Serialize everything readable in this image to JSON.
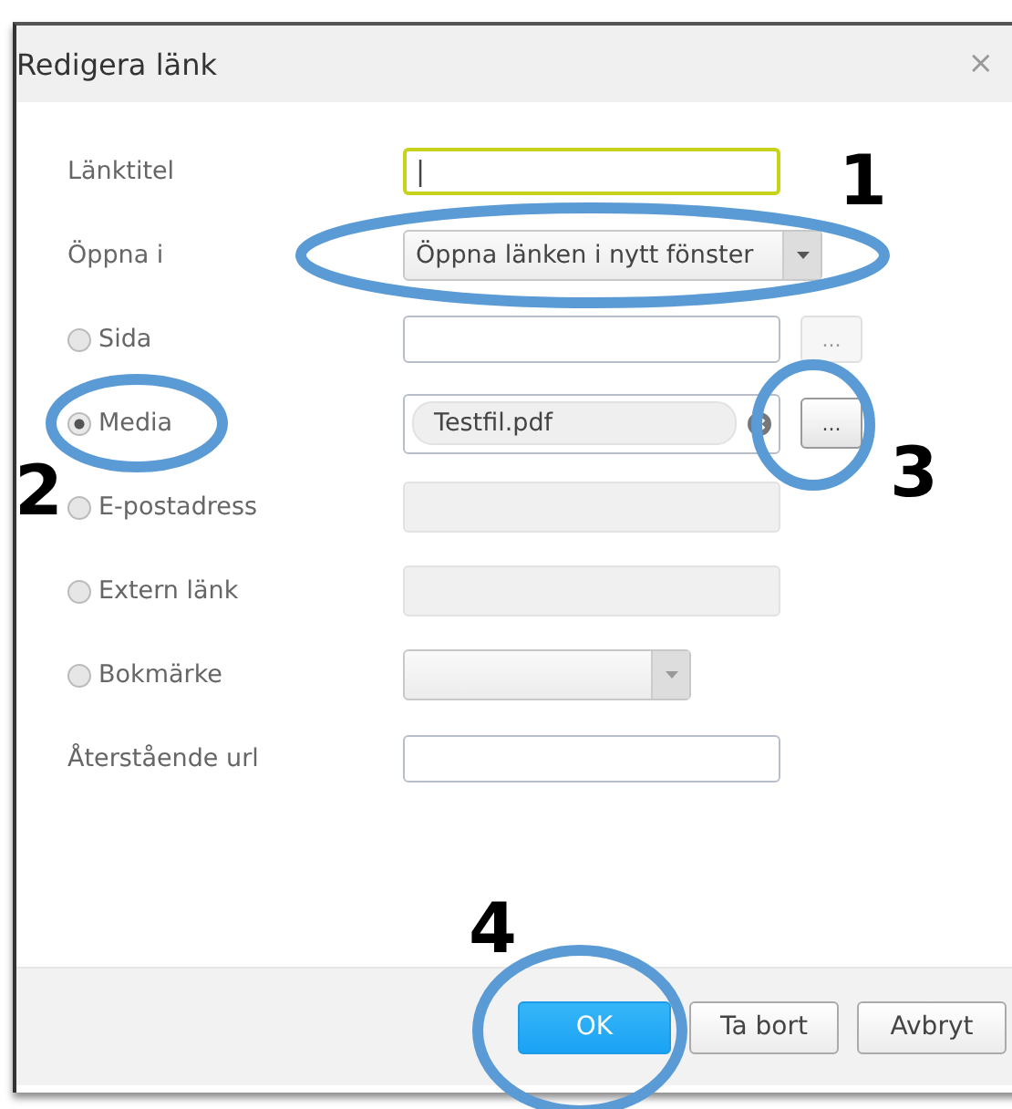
{
  "dialog": {
    "title": "Redigera länk",
    "close": "×"
  },
  "rows": [
    {
      "label": "Länktitel",
      "radio": false,
      "field": {
        "kind": "input",
        "focused": true,
        "caret": "|"
      }
    },
    {
      "label": "Öppna i",
      "radio": false,
      "field": {
        "kind": "select",
        "value": "Öppna länken i nytt fönster",
        "disabled": false
      }
    },
    {
      "label": "Sida",
      "radio": true,
      "selected": false,
      "field": {
        "kind": "input",
        "focused": false
      },
      "browse": {
        "label": "...",
        "disabled": true
      }
    },
    {
      "label": "Media",
      "radio": true,
      "selected": true,
      "field": {
        "kind": "file",
        "value": "Testfil.pdf"
      },
      "browse": {
        "label": "...",
        "disabled": false
      }
    },
    {
      "label": "E-postadress",
      "radio": true,
      "selected": false,
      "field": {
        "kind": "disabled"
      }
    },
    {
      "label": "Extern länk",
      "radio": true,
      "selected": false,
      "field": {
        "kind": "disabled"
      }
    },
    {
      "label": "Bokmärke",
      "radio": true,
      "selected": false,
      "field": {
        "kind": "select",
        "disabled": true
      }
    },
    {
      "label": "Återstående url",
      "radio": false,
      "field": {
        "kind": "input",
        "focused": false
      }
    }
  ],
  "buttons": [
    {
      "label": "OK",
      "primary": true
    },
    {
      "label": "Ta bort",
      "primary": false
    },
    {
      "label": "Avbryt",
      "primary": false
    }
  ],
  "annotations": [
    {
      "number": "1"
    },
    {
      "number": "2"
    },
    {
      "number": "3"
    },
    {
      "number": "4"
    }
  ]
}
